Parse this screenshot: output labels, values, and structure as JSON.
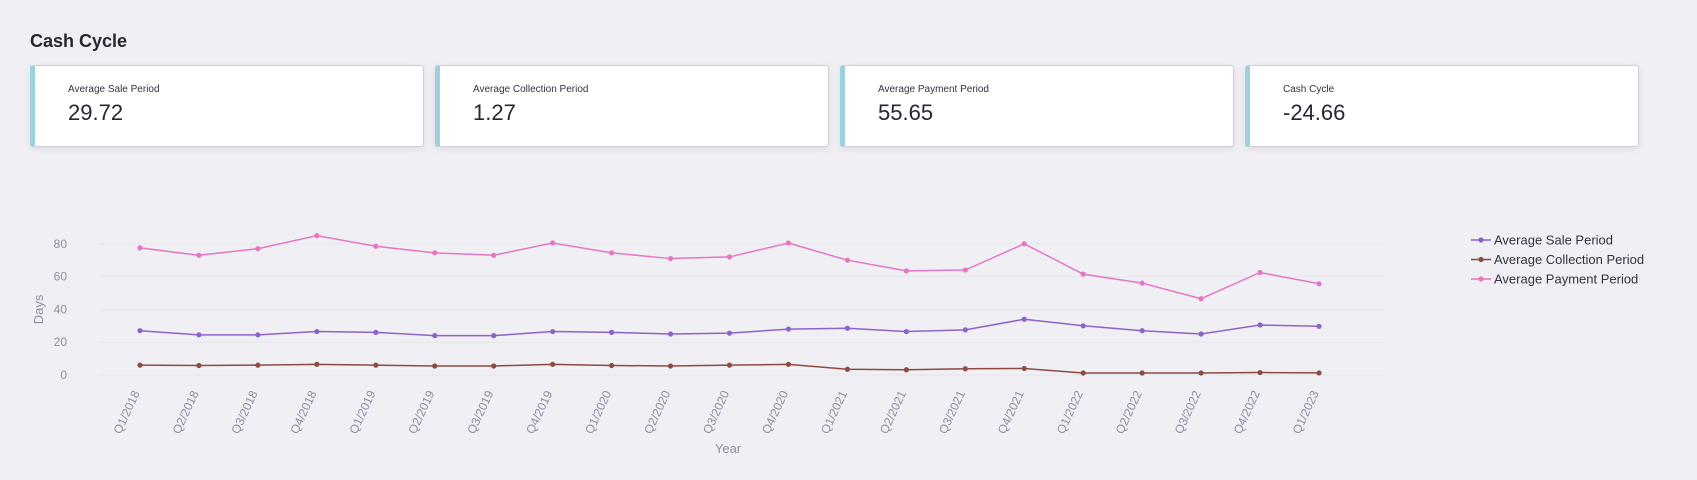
{
  "page": {
    "title": "Cash Cycle"
  },
  "metrics": [
    {
      "label": "Average Sale Period",
      "value": "29.72"
    },
    {
      "label": "Average Collection Period",
      "value": "1.27"
    },
    {
      "label": "Average Payment Period",
      "value": "55.65"
    },
    {
      "label": "Cash Cycle",
      "value": "-24.66"
    }
  ],
  "colors": {
    "card_accent": "#9ad3de"
  },
  "chart_data": {
    "type": "line",
    "xlabel": "Year",
    "ylabel": "Days",
    "ylim": [
      0,
      90
    ],
    "yticks": [
      0,
      20,
      40,
      60,
      80
    ],
    "grid": true,
    "legend_position": "top-right",
    "categories": [
      "Q1/2018",
      "Q2/2018",
      "Q3/2018",
      "Q4/2018",
      "Q1/2019",
      "Q2/2019",
      "Q3/2019",
      "Q4/2019",
      "Q1/2020",
      "Q2/2020",
      "Q3/2020",
      "Q4/2020",
      "Q1/2021",
      "Q2/2021",
      "Q3/2021",
      "Q4/2021",
      "Q1/2022",
      "Q2/2022",
      "Q3/2022",
      "Q4/2022",
      "Q1/2023"
    ],
    "series": [
      {
        "name": "Average Sale Period",
        "color": "#8e63c8",
        "values": [
          27,
          24.5,
          24.5,
          26.5,
          26,
          24,
          24,
          26.5,
          26,
          25,
          25.5,
          28,
          28.5,
          26.5,
          27.5,
          34,
          30,
          27,
          25,
          30.5,
          29.7
        ]
      },
      {
        "name": "Average Collection Period",
        "color": "#8c4c44",
        "values": [
          6,
          5.8,
          6,
          6.5,
          6,
          5.5,
          5.5,
          6.5,
          5.8,
          5.5,
          6,
          6.5,
          3.5,
          3.2,
          3.8,
          4,
          1.2,
          1.2,
          1.2,
          1.5,
          1.27
        ]
      },
      {
        "name": "Average Payment Period",
        "color": "#e377c2",
        "values": [
          77.5,
          73,
          77,
          85,
          78.5,
          74.5,
          73,
          80.5,
          74.5,
          71,
          72,
          80.5,
          70,
          63.5,
          64,
          80,
          61.5,
          56,
          46.5,
          62.5,
          55.65
        ]
      }
    ]
  }
}
